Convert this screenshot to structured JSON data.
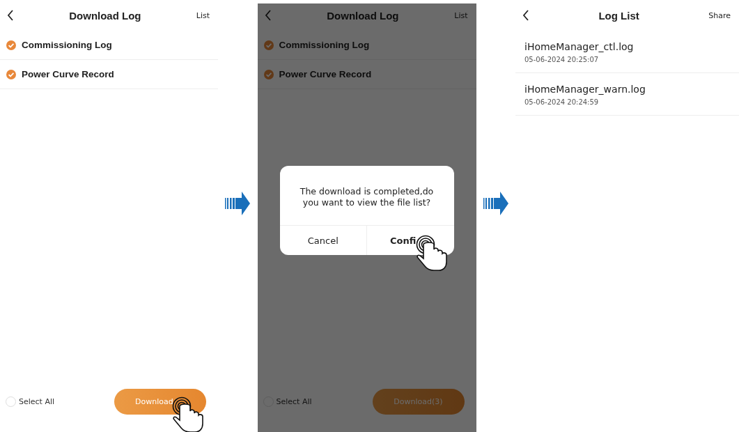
{
  "screens": [
    {
      "kind": "selection",
      "dimmed": false,
      "nav": {
        "title": "Download Log",
        "action": "List"
      },
      "items": [
        {
          "label": "Commissioning Log",
          "checked": true
        },
        {
          "label": "Power Curve Record",
          "checked": true
        }
      ],
      "select_all": {
        "label": "Select All",
        "checked": false
      },
      "download_button": {
        "label": "Download",
        "tapped": true
      }
    },
    {
      "kind": "selection",
      "dimmed": true,
      "nav": {
        "title": "Download Log",
        "action": "List"
      },
      "items": [
        {
          "label": "Commissioning Log",
          "checked": true
        },
        {
          "label": "Power Curve Record",
          "checked": true
        }
      ],
      "select_all": {
        "label": "Select All",
        "checked": false
      },
      "download_button": {
        "label": "Download(3)",
        "tapped": false
      },
      "dialog": {
        "message": "The download is completed,do you want to view the file list?",
        "buttons": [
          {
            "label": "Cancel",
            "kind": "cancel",
            "tapped": false
          },
          {
            "label": "Confi",
            "kind": "confirm",
            "tapped": true
          }
        ]
      }
    },
    {
      "kind": "list",
      "nav": {
        "title": "Log List",
        "action": "Share"
      },
      "files": [
        {
          "name": "iHomeManager_ctl.log",
          "time": "05-06-2024 20:25:07"
        },
        {
          "name": "iHomeManager_warn.log",
          "time": "05-06-2024 20:24:59"
        }
      ]
    }
  ]
}
